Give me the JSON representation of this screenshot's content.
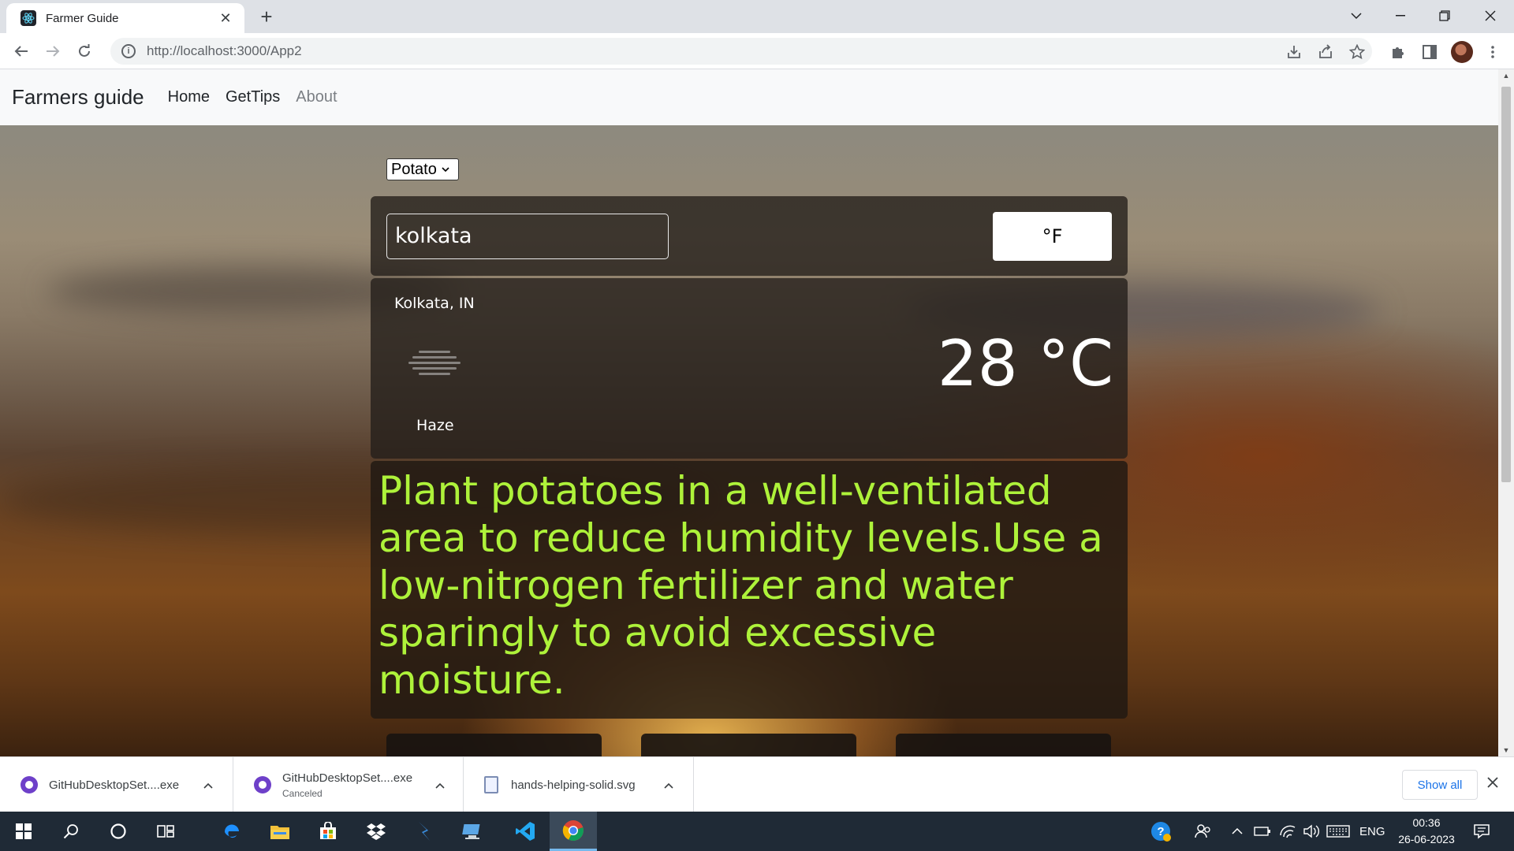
{
  "browser": {
    "tab_title": "Farmer Guide",
    "tab_close": "✕",
    "new_tab": "+",
    "url": "http://localhost:3000/App2"
  },
  "navbar": {
    "brand": "Farmers guide",
    "links": [
      "Home",
      "GetTips",
      "About"
    ]
  },
  "crop_select": {
    "value": "Potato"
  },
  "search": {
    "city_value": "kolkata",
    "unit_button": "°F"
  },
  "weather": {
    "location": "Kolkata, IN",
    "condition": "Haze",
    "temperature": "28 °C"
  },
  "tip": {
    "text": "Plant potatoes in a well-ventilated area to reduce humidity levels.Use a low-nitrogen fertilizer and water sparingly to avoid excessive moisture."
  },
  "downloads": {
    "items": [
      {
        "name": "GitHubDesktopSet....exe",
        "status": ""
      },
      {
        "name": "GitHubDesktopSet....exe",
        "status": "Canceled"
      },
      {
        "name": "hands-helping-solid.svg",
        "status": ""
      }
    ],
    "show_all": "Show all"
  },
  "taskbar": {
    "language": "ENG",
    "time": "00:36",
    "date": "26-06-2023"
  },
  "colors": {
    "tip_text": "#aef23a",
    "accent_blue": "#1a73e8",
    "taskbar": "#1f2a36"
  }
}
